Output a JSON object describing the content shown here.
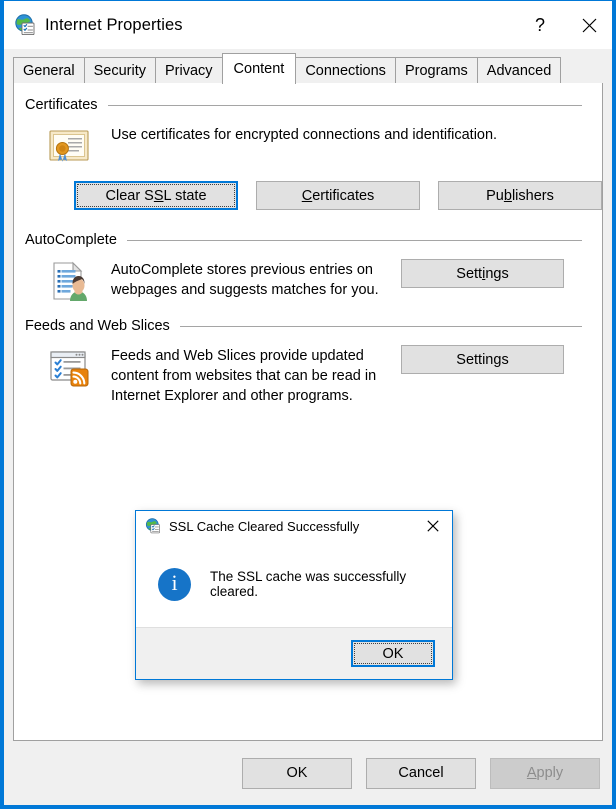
{
  "window": {
    "title": "Internet Properties",
    "icon": "internet-properties-icon",
    "help_button": "?",
    "close_button": "✕"
  },
  "tabs": [
    {
      "label": "General",
      "active": false
    },
    {
      "label": "Security",
      "active": false
    },
    {
      "label": "Privacy",
      "active": false
    },
    {
      "label": "Content",
      "active": true
    },
    {
      "label": "Connections",
      "active": false
    },
    {
      "label": "Programs",
      "active": false
    },
    {
      "label": "Advanced",
      "active": false
    }
  ],
  "sections": {
    "certificates": {
      "group_label": "Certificates",
      "icon": "certificate-icon",
      "description": "Use certificates for encrypted connections and identification.",
      "buttons": [
        {
          "label": "Clear SSL state",
          "accel_index": 7,
          "focused": true,
          "disabled": false
        },
        {
          "label": "Certificates",
          "accel_index": 0,
          "focused": false,
          "disabled": false
        },
        {
          "label": "Publishers",
          "accel_index": 2,
          "focused": false,
          "disabled": false
        }
      ]
    },
    "autocomplete": {
      "group_label": "AutoComplete",
      "icon": "autocomplete-icon",
      "description": "AutoComplete stores previous entries on webpages and suggests matches for you.",
      "button": {
        "label": "Settings",
        "accel_index": 4,
        "focused": false,
        "disabled": false
      }
    },
    "feeds": {
      "group_label": "Feeds and Web Slices",
      "icon": "feeds-icon",
      "description": "Feeds and Web Slices provide updated content from websites that can be read in Internet Explorer and other programs.",
      "button": {
        "label": "Settings",
        "accel_index": 6,
        "focused": false,
        "disabled": false
      }
    }
  },
  "footer": {
    "ok": "OK",
    "cancel": "Cancel",
    "apply": "Apply",
    "apply_accel_index": 0,
    "apply_disabled": true
  },
  "modal": {
    "title": "SSL Cache Cleared Successfully",
    "icon": "internet-properties-icon",
    "close_button": "✕",
    "info_glyph": "i",
    "message": "The SSL cache was successfully cleared.",
    "ok_button": "OK",
    "ok_focused": true
  },
  "colors": {
    "accent": "#0078d7",
    "info_blue": "#1674c8",
    "window_bg": "#f0f0f0",
    "panel_bg": "#ffffff",
    "button_face": "#e1e1e1",
    "button_border": "#adadad",
    "disabled_text": "#8d8d8d",
    "group_line": "#a5a5a5"
  }
}
